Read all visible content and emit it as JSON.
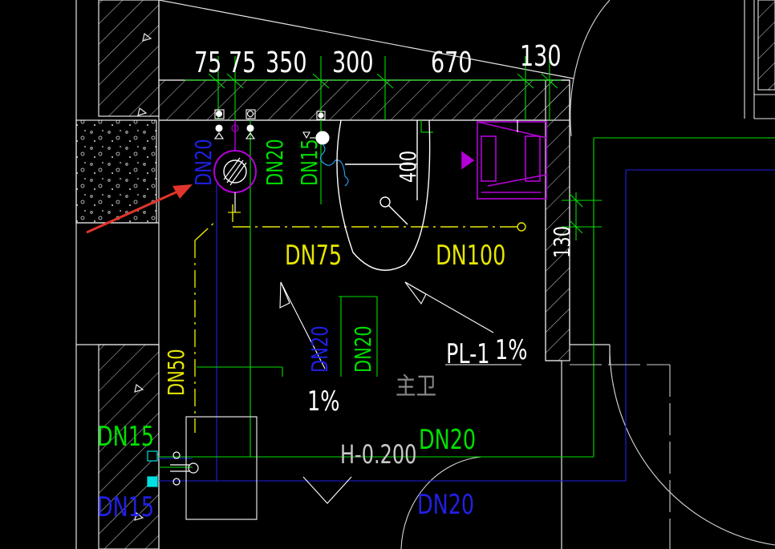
{
  "colors": {
    "background": "#000000",
    "wall": "#e6e6e6",
    "water_supply": "#00e000",
    "drainage": "#e6e600",
    "hot_water": "#2020e6",
    "fixture": "#ffffff",
    "equipment": "#b400d8",
    "arrow": "#e0352a"
  },
  "dimensions": [
    "75",
    "75",
    "350",
    "300",
    "670",
    "130"
  ],
  "dim_400": "400",
  "dim_130_right": "130",
  "labels": {
    "dn20_blue_top": "DN20",
    "dn20_green_top": "DN20",
    "dn15_green_top": "DN15",
    "dn75": "DN75",
    "dn100": "DN100",
    "dn20_blue_mid": "DN20",
    "dn20_green_mid": "DN20",
    "pl1": "PL-1",
    "slope_pl": "1%",
    "room_name": "主卫",
    "slope_floor": "1%",
    "dn50": "DN50",
    "dn15_green_left": "DN15",
    "dn20_green_bottom": "DN20",
    "elevation": "H-0.200",
    "dn15_blue_left": "DN15",
    "dn20_blue_bottom": "DN20"
  },
  "icons": {
    "highlight_arrow": "red-arrow-icon",
    "drain_riser": "riser-circle-icon",
    "water_heater": "water-heater-icon",
    "valve": "valve-icon",
    "toilet": "toilet-icon"
  }
}
